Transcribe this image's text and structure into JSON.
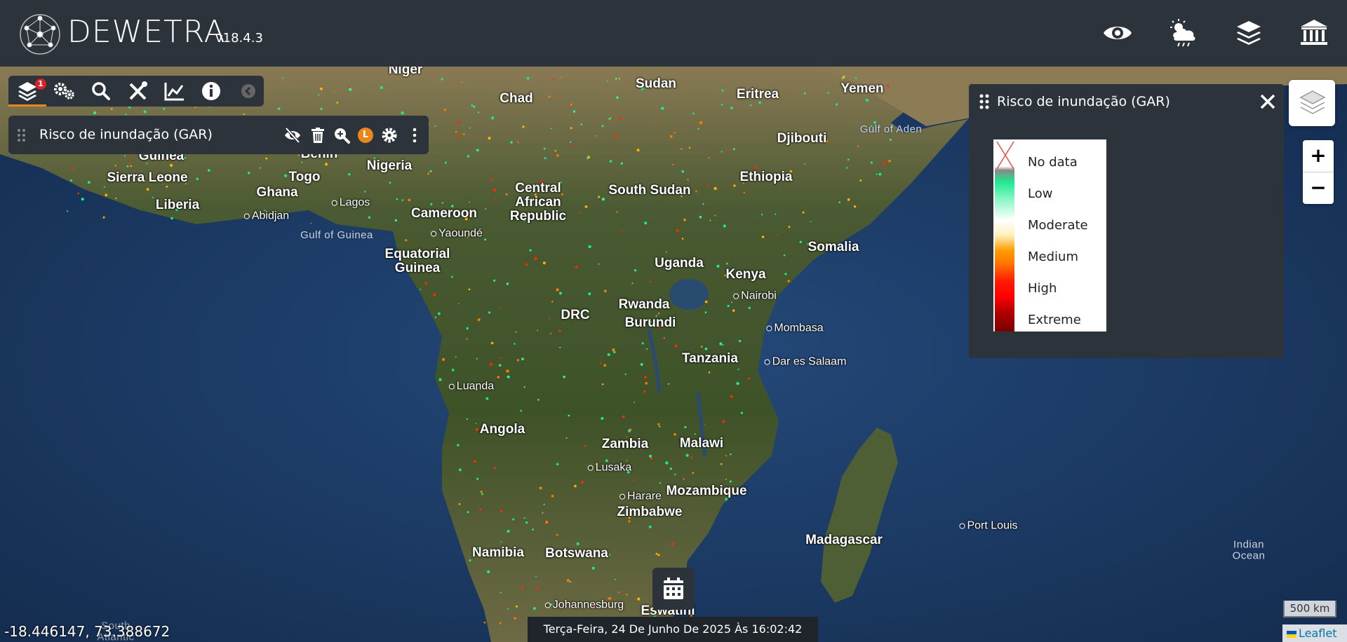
{
  "header": {
    "brand": "DEWETRA",
    "version": "v18.4.3",
    "icons": [
      "eye-icon",
      "weather-icon",
      "layers-icon",
      "institution-icon"
    ]
  },
  "toolbar": {
    "badge": "1",
    "buttons": [
      "layers-icon",
      "settings-icon",
      "search-icon",
      "tools-icon",
      "chart-icon",
      "info-icon",
      "collapse-icon"
    ]
  },
  "layer_row": {
    "name": "Risco de inundação (GAR)",
    "opacity_label": "L"
  },
  "legend": {
    "title": "Risco de inundação (GAR)",
    "entries": [
      "No data",
      "Low",
      "Moderate",
      "Medium",
      "High",
      "Extreme"
    ]
  },
  "map": {
    "countries": [
      {
        "name": "Niger"
      },
      {
        "name": "Chad"
      },
      {
        "name": "Sudan"
      },
      {
        "name": "Eritrea"
      },
      {
        "name": "Yemen"
      },
      {
        "name": "Djibouti"
      },
      {
        "name": "Guinea"
      },
      {
        "name": "Benin"
      },
      {
        "name": "Nigeria"
      },
      {
        "name": "Sierra Leone"
      },
      {
        "name": "Togo"
      },
      {
        "name": "Ghana"
      },
      {
        "name": "Liberia"
      },
      {
        "name": "Central\nAfrican\nRepublic"
      },
      {
        "name": "South Sudan"
      },
      {
        "name": "Ethiopia"
      },
      {
        "name": "Cameroon"
      },
      {
        "name": "Somalia"
      },
      {
        "name": "Equatorial\nGuinea"
      },
      {
        "name": "Uganda"
      },
      {
        "name": "Kenya"
      },
      {
        "name": "DRC"
      },
      {
        "name": "Rwanda"
      },
      {
        "name": "Burundi"
      },
      {
        "name": "Tanzania"
      },
      {
        "name": "Angola"
      },
      {
        "name": "Zambia"
      },
      {
        "name": "Malawi"
      },
      {
        "name": "Mozambique"
      },
      {
        "name": "Zimbabwe"
      },
      {
        "name": "Madagascar"
      },
      {
        "name": "Namibia"
      },
      {
        "name": "Botswana"
      },
      {
        "name": "Eswatini"
      }
    ],
    "cities": [
      {
        "name": "Lagos"
      },
      {
        "name": "Abidjan"
      },
      {
        "name": "Yaoundé"
      },
      {
        "name": "Nairobi"
      },
      {
        "name": "Mombasa"
      },
      {
        "name": "Dar es Salaam"
      },
      {
        "name": "Luanda"
      },
      {
        "name": "Lusaka"
      },
      {
        "name": "Harare"
      },
      {
        "name": "Port Louis"
      },
      {
        "name": "Johannesburg"
      }
    ],
    "water": [
      {
        "name": "Gulf of Aden"
      },
      {
        "name": "Gulf of Guinea"
      },
      {
        "name": "Indian\nOcean"
      },
      {
        "name": "South\nAtlantic"
      }
    ]
  },
  "coords": "-18.446147, 73.388672",
  "datetime": "Terça-Feira, 24 De Junho De 2025 Às 16:02:42",
  "scale": "500 km",
  "attribution": "Leaflet",
  "zoom": {
    "in": "+",
    "out": "−"
  }
}
